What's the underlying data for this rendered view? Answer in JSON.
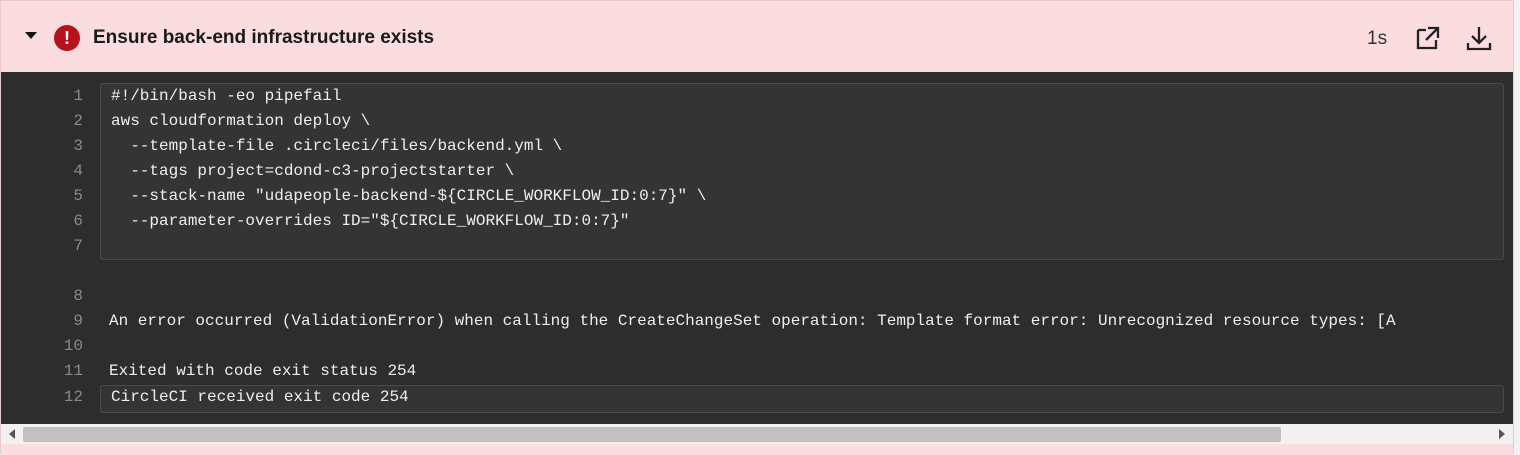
{
  "step": {
    "title": "Ensure back-end infrastructure exists",
    "duration": "1s",
    "status_icon": "!",
    "icons": {
      "collapse": "chevron-down-icon",
      "status": "error-icon",
      "open": "external-link-icon",
      "download": "download-icon"
    }
  },
  "command": [
    {
      "n": "1",
      "text": "#!/bin/bash -eo pipefail"
    },
    {
      "n": "2",
      "text": "aws cloudformation deploy \\"
    },
    {
      "n": "3",
      "text": "  --template-file .circleci/files/backend.yml \\"
    },
    {
      "n": "4",
      "text": "  --tags project=cdond-c3-projectstarter \\"
    },
    {
      "n": "5",
      "text": "  --stack-name \"udapeople-backend-${CIRCLE_WORKFLOW_ID:0:7}\" \\"
    },
    {
      "n": "6",
      "text": "  --parameter-overrides ID=\"${CIRCLE_WORKFLOW_ID:0:7}\""
    },
    {
      "n": "7",
      "text": ""
    }
  ],
  "output": [
    {
      "n": "8",
      "text": ""
    },
    {
      "n": "9",
      "text": "An error occurred (ValidationError) when calling the CreateChangeSet operation: Template format error: Unrecognized resource types: [A"
    },
    {
      "n": "10",
      "text": ""
    },
    {
      "n": "11",
      "text": "Exited with code exit status 254"
    }
  ],
  "final": {
    "n": "12",
    "text": "CircleCI received exit code 254"
  },
  "colors": {
    "error_bg": "#fbdcdf",
    "error_icon": "#b5121b",
    "log_bg": "#2d2d2d"
  }
}
